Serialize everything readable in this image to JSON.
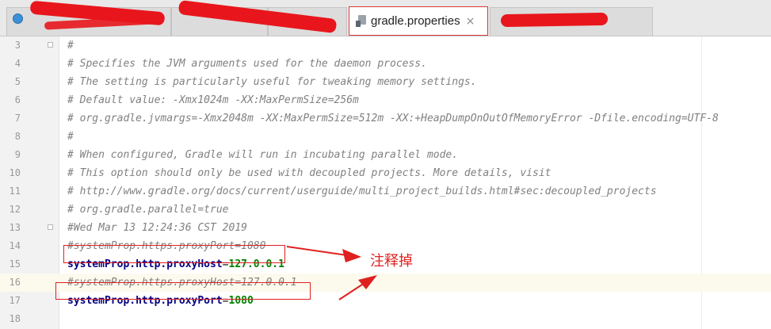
{
  "tabs": {
    "active_label": "gradle.properties",
    "close_glyph": "×"
  },
  "lines": [
    {
      "number": "3",
      "kind": "comment",
      "text": "#"
    },
    {
      "number": "4",
      "kind": "comment",
      "text": "# Specifies the JVM arguments used for the daemon process."
    },
    {
      "number": "5",
      "kind": "comment",
      "text": "# The setting is particularly useful for tweaking memory settings."
    },
    {
      "number": "6",
      "kind": "comment",
      "text": "# Default value: -Xmx1024m -XX:MaxPermSize=256m"
    },
    {
      "number": "7",
      "kind": "comment",
      "text": "# org.gradle.jvmargs=-Xmx2048m -XX:MaxPermSize=512m -XX:+HeapDumpOnOutOfMemoryError -Dfile.encoding=UTF-8"
    },
    {
      "number": "8",
      "kind": "comment",
      "text": "#"
    },
    {
      "number": "9",
      "kind": "comment",
      "text": "# When configured, Gradle will run in incubating parallel mode."
    },
    {
      "number": "10",
      "kind": "comment",
      "text": "# This option should only be used with decoupled projects. More details, visit"
    },
    {
      "number": "11",
      "kind": "comment",
      "text": "# http://www.gradle.org/docs/current/userguide/multi_project_builds.html#sec:decoupled_projects"
    },
    {
      "number": "12",
      "kind": "comment",
      "text": "# org.gradle.parallel=true"
    },
    {
      "number": "13",
      "kind": "comment",
      "text": "#Wed Mar 13 12:24:36 CST 2019"
    },
    {
      "number": "14",
      "kind": "comment",
      "text": "#systemProp.https.proxyPort=1080"
    },
    {
      "number": "15",
      "kind": "property",
      "key": "systemProp.http.proxyHost",
      "eq": "=",
      "value": "127.0.0.1"
    },
    {
      "number": "16",
      "kind": "comment",
      "text": "#systemProp.https.proxyHost=127.0.0.1"
    },
    {
      "number": "17",
      "kind": "property",
      "key": "systemProp.http.proxyPort",
      "eq": "=",
      "value": "1080"
    },
    {
      "number": "18",
      "kind": "empty",
      "text": ""
    }
  ],
  "annotation": {
    "text": "注释掉"
  },
  "colors": {
    "annotation_red": "#e02020",
    "comment_gray": "#808080",
    "key_navy": "#000080",
    "value_green": "#008000",
    "current_line": "#fcfaed"
  }
}
